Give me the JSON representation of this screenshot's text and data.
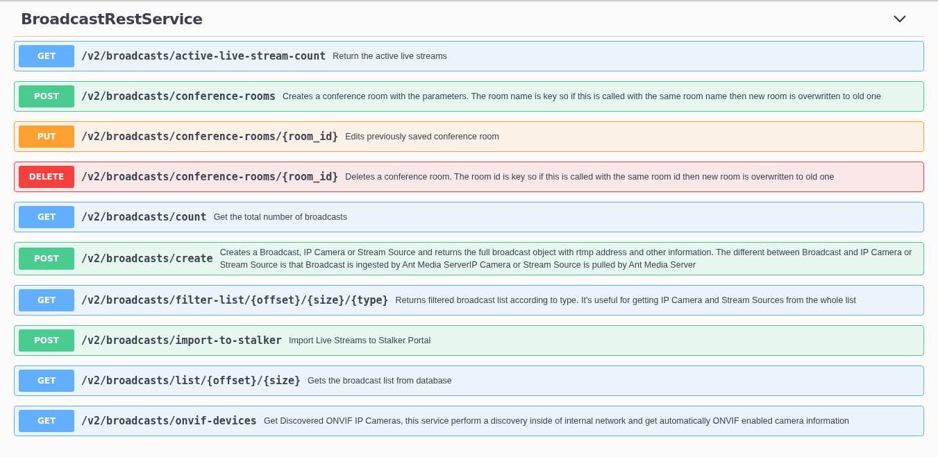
{
  "section": {
    "title": "BroadcastRestService",
    "expanded": true
  },
  "operations": [
    {
      "kind": "get",
      "method": "GET",
      "path": "/v2/broadcasts/active-live-stream-count",
      "summary": "Return the active live streams"
    },
    {
      "kind": "post",
      "method": "POST",
      "path": "/v2/broadcasts/conference-rooms",
      "summary": "Creates a conference room with the parameters. The room name is key so if this is called with the same room name then new room is overwritten to old one"
    },
    {
      "kind": "put",
      "method": "PUT",
      "path": "/v2/broadcasts/conference-rooms/{room_id}",
      "summary": "Edits previously saved conference room"
    },
    {
      "kind": "delete",
      "method": "DELETE",
      "path": "/v2/broadcasts/conference-rooms/{room_id}",
      "summary": "Deletes a conference room. The room id is key so if this is called with the same room id then new room is overwritten to old one"
    },
    {
      "kind": "get",
      "method": "GET",
      "path": "/v2/broadcasts/count",
      "summary": "Get the total number of broadcasts"
    },
    {
      "kind": "post",
      "method": "POST",
      "path": "/v2/broadcasts/create",
      "summary": "Creates a Broadcast, IP Camera or Stream Source and returns the full broadcast object with rtmp address and other information. The different between Broadcast and IP Camera or Stream Source is that Broadcast is ingested by Ant Media ServerIP Camera or Stream Source is pulled by Ant Media Server"
    },
    {
      "kind": "get",
      "method": "GET",
      "path": "/v2/broadcasts/filter-list/{offset}/{size}/{type}",
      "summary": "Returns filtered broadcast list according to type. It's useful for getting IP Camera and Stream Sources from the whole list"
    },
    {
      "kind": "post",
      "method": "POST",
      "path": "/v2/broadcasts/import-to-stalker",
      "summary": "Import Live Streams to Stalker Portal"
    },
    {
      "kind": "get",
      "method": "GET",
      "path": "/v2/broadcasts/list/{offset}/{size}",
      "summary": "Gets the broadcast list from database"
    },
    {
      "kind": "get",
      "method": "GET",
      "path": "/v2/broadcasts/onvif-devices",
      "summary": "Get Discovered ONVIF IP Cameras, this service perform a discovery inside of internal network and get automatically ONVIF enabled camera information"
    }
  ]
}
